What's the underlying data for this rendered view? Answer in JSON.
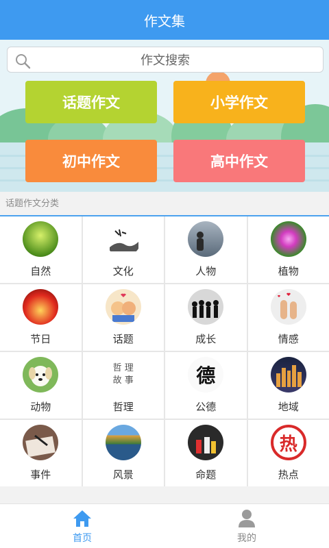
{
  "app": {
    "title": "作文集"
  },
  "search": {
    "placeholder": "作文搜索"
  },
  "categories": [
    {
      "label": "话题作文",
      "color": "#b4d331"
    },
    {
      "label": "小学作文",
      "color": "#f8b21c"
    },
    {
      "label": "初中作文",
      "color": "#f98b3c"
    },
    {
      "label": "高中作文",
      "color": "#f9787a"
    }
  ],
  "section": {
    "title": "话题作文分类"
  },
  "topics": [
    {
      "label": "自然",
      "icon": "grass-photo"
    },
    {
      "label": "文化",
      "icon": "ink-painting"
    },
    {
      "label": "人物",
      "icon": "person-by-sea-photo"
    },
    {
      "label": "植物",
      "icon": "pink-flower-photo"
    },
    {
      "label": "节日",
      "icon": "lanterns-photo"
    },
    {
      "label": "话题",
      "icon": "cartoon-couple"
    },
    {
      "label": "成长",
      "icon": "silhouettes"
    },
    {
      "label": "情感",
      "icon": "finger-puppets"
    },
    {
      "label": "动物",
      "icon": "puppy-photo"
    },
    {
      "label": "哲理",
      "icon": "philosophy-text",
      "thumb_text": [
        "哲 理",
        "故 事"
      ]
    },
    {
      "label": "公德",
      "icon": "calligraphy-de",
      "thumb_text": [
        "德"
      ]
    },
    {
      "label": "地域",
      "icon": "city-night-photo"
    },
    {
      "label": "事件",
      "icon": "writing-hand-photo"
    },
    {
      "label": "风景",
      "icon": "lake-landscape-photo"
    },
    {
      "label": "命题",
      "icon": "candles-photo"
    },
    {
      "label": "热点",
      "icon": "hot-stamp",
      "thumb_text": [
        "热"
      ]
    }
  ],
  "tabbar": {
    "home": {
      "label": "首页",
      "icon": "home-icon"
    },
    "mine": {
      "label": "我的",
      "icon": "user-icon"
    }
  },
  "colors": {
    "primary": "#3e9af0",
    "muted_tab": "#888888"
  }
}
